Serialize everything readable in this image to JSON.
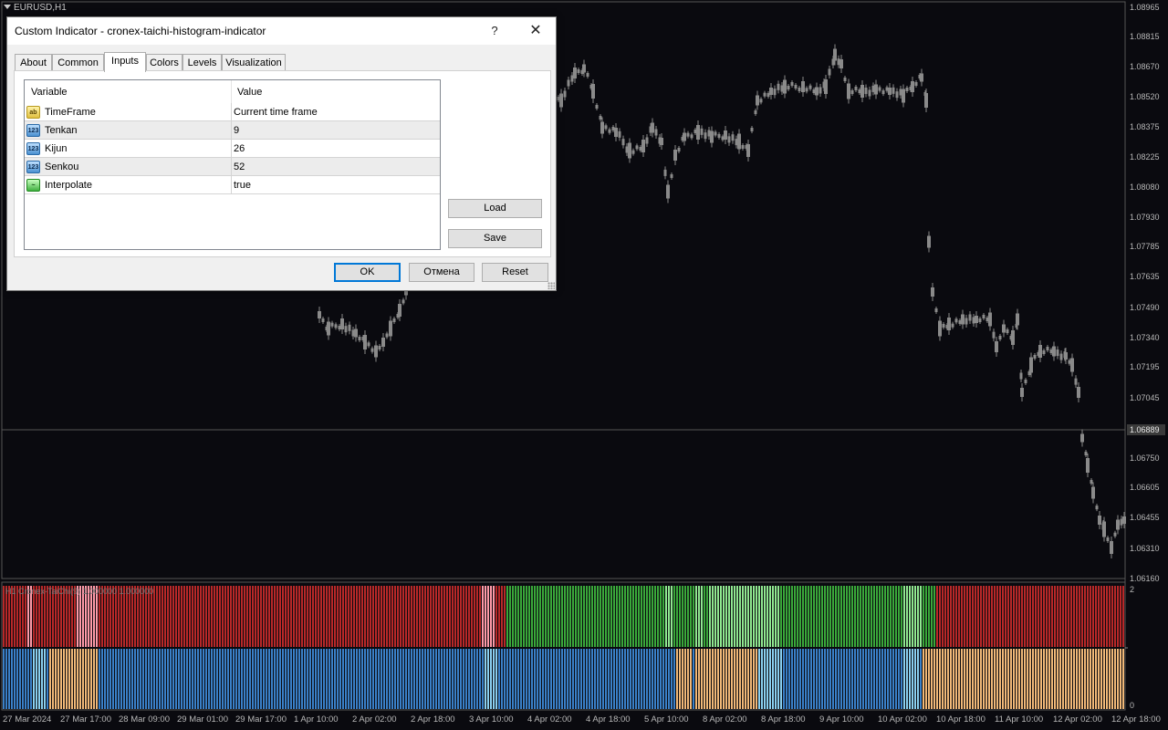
{
  "chart": {
    "symbol": "EURUSD,H1",
    "indicator_label": "H1 Cronex-TaiChi(9) 1.000000 1.000000",
    "current_price": "1.06889",
    "price_scale": [
      "1.08965",
      "1.08815",
      "1.08670",
      "1.08520",
      "1.08375",
      "1.08225",
      "1.08080",
      "1.07930",
      "1.07785",
      "1.07635",
      "1.07490",
      "1.07340",
      "1.07195",
      "1.07045",
      "1.06750",
      "1.06605",
      "1.06455",
      "1.06310",
      "1.06160"
    ],
    "sub_scale": [
      "2",
      "0"
    ],
    "time_labels": [
      "27 Mar 2024",
      "27 Mar 17:00",
      "28 Mar 09:00",
      "29 Mar 01:00",
      "29 Mar 17:00",
      "1 Apr 10:00",
      "2 Apr 02:00",
      "2 Apr 18:00",
      "3 Apr 10:00",
      "4 Apr 02:00",
      "4 Apr 18:00",
      "5 Apr 10:00",
      "8 Apr 02:00",
      "8 Apr 18:00",
      "9 Apr 10:00",
      "10 Apr 02:00",
      "10 Apr 18:00",
      "11 Apr 10:00",
      "12 Apr 02:00",
      "12 Apr 18:00"
    ],
    "colors": {
      "background": "#0a0a0f",
      "candle": "#8a8a8a",
      "hist_red": "#b82828",
      "hist_pink": "#ff9aa8",
      "hist_green": "#3aa83a",
      "hist_lightgreen": "#90e890",
      "hist_blue": "#3a80c8",
      "hist_lightblue": "#8ad0f0",
      "hist_orange": "#f0b878"
    }
  },
  "dialog": {
    "title": "Custom Indicator - cronex-taichi-histogram-indicator",
    "help": "?",
    "close": "✕",
    "tabs": [
      {
        "label": "About"
      },
      {
        "label": "Common"
      },
      {
        "label": "Inputs"
      },
      {
        "label": "Colors"
      },
      {
        "label": "Levels"
      },
      {
        "label": "Visualization"
      }
    ],
    "active_tab": "Inputs",
    "table": {
      "headers": [
        "Variable",
        "Value"
      ],
      "rows": [
        {
          "icon": "ab",
          "icon_name": "string-type-icon",
          "name": "TimeFrame",
          "value": "Current time frame"
        },
        {
          "icon": "123",
          "icon_name": "integer-type-icon",
          "name": "Tenkan",
          "value": "9"
        },
        {
          "icon": "123",
          "icon_name": "integer-type-icon",
          "name": "Kijun",
          "value": "26"
        },
        {
          "icon": "123",
          "icon_name": "integer-type-icon",
          "name": "Senkou",
          "value": "52"
        },
        {
          "icon": "~",
          "icon_name": "bool-type-icon",
          "name": "Interpolate",
          "value": "true"
        }
      ]
    },
    "buttons": {
      "load": "Load",
      "save": "Save",
      "ok": "OK",
      "cancel": "Отмена",
      "reset": "Reset"
    }
  }
}
